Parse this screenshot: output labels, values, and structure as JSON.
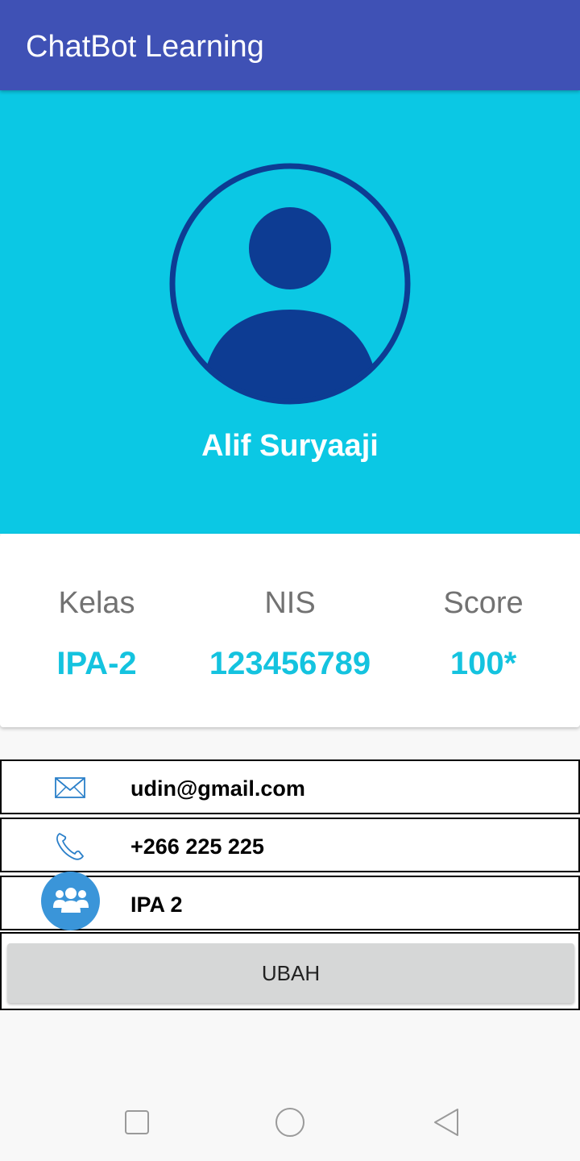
{
  "appbar": {
    "title": "ChatBot Learning"
  },
  "profile": {
    "name": "Alif Suryaaji",
    "avatar_icon": "user-avatar-icon"
  },
  "stats": [
    {
      "label": "Kelas",
      "value": "IPA-2"
    },
    {
      "label": "NIS",
      "value": "123456789"
    },
    {
      "label": "Score",
      "value": "100*"
    }
  ],
  "info": {
    "email": "udin@gmail.com",
    "phone": "+266 225 225",
    "class": "IPA 2"
  },
  "button": {
    "label": "UBAH"
  },
  "navbar": {
    "icons": [
      "recent-apps-icon",
      "home-icon",
      "back-icon"
    ]
  },
  "colors": {
    "appbar": "#3f51b5",
    "hero": "#0bc8e4",
    "accent_value": "#14c3df",
    "avatar": "#0d3c93",
    "group_badge": "#3a95d9"
  }
}
